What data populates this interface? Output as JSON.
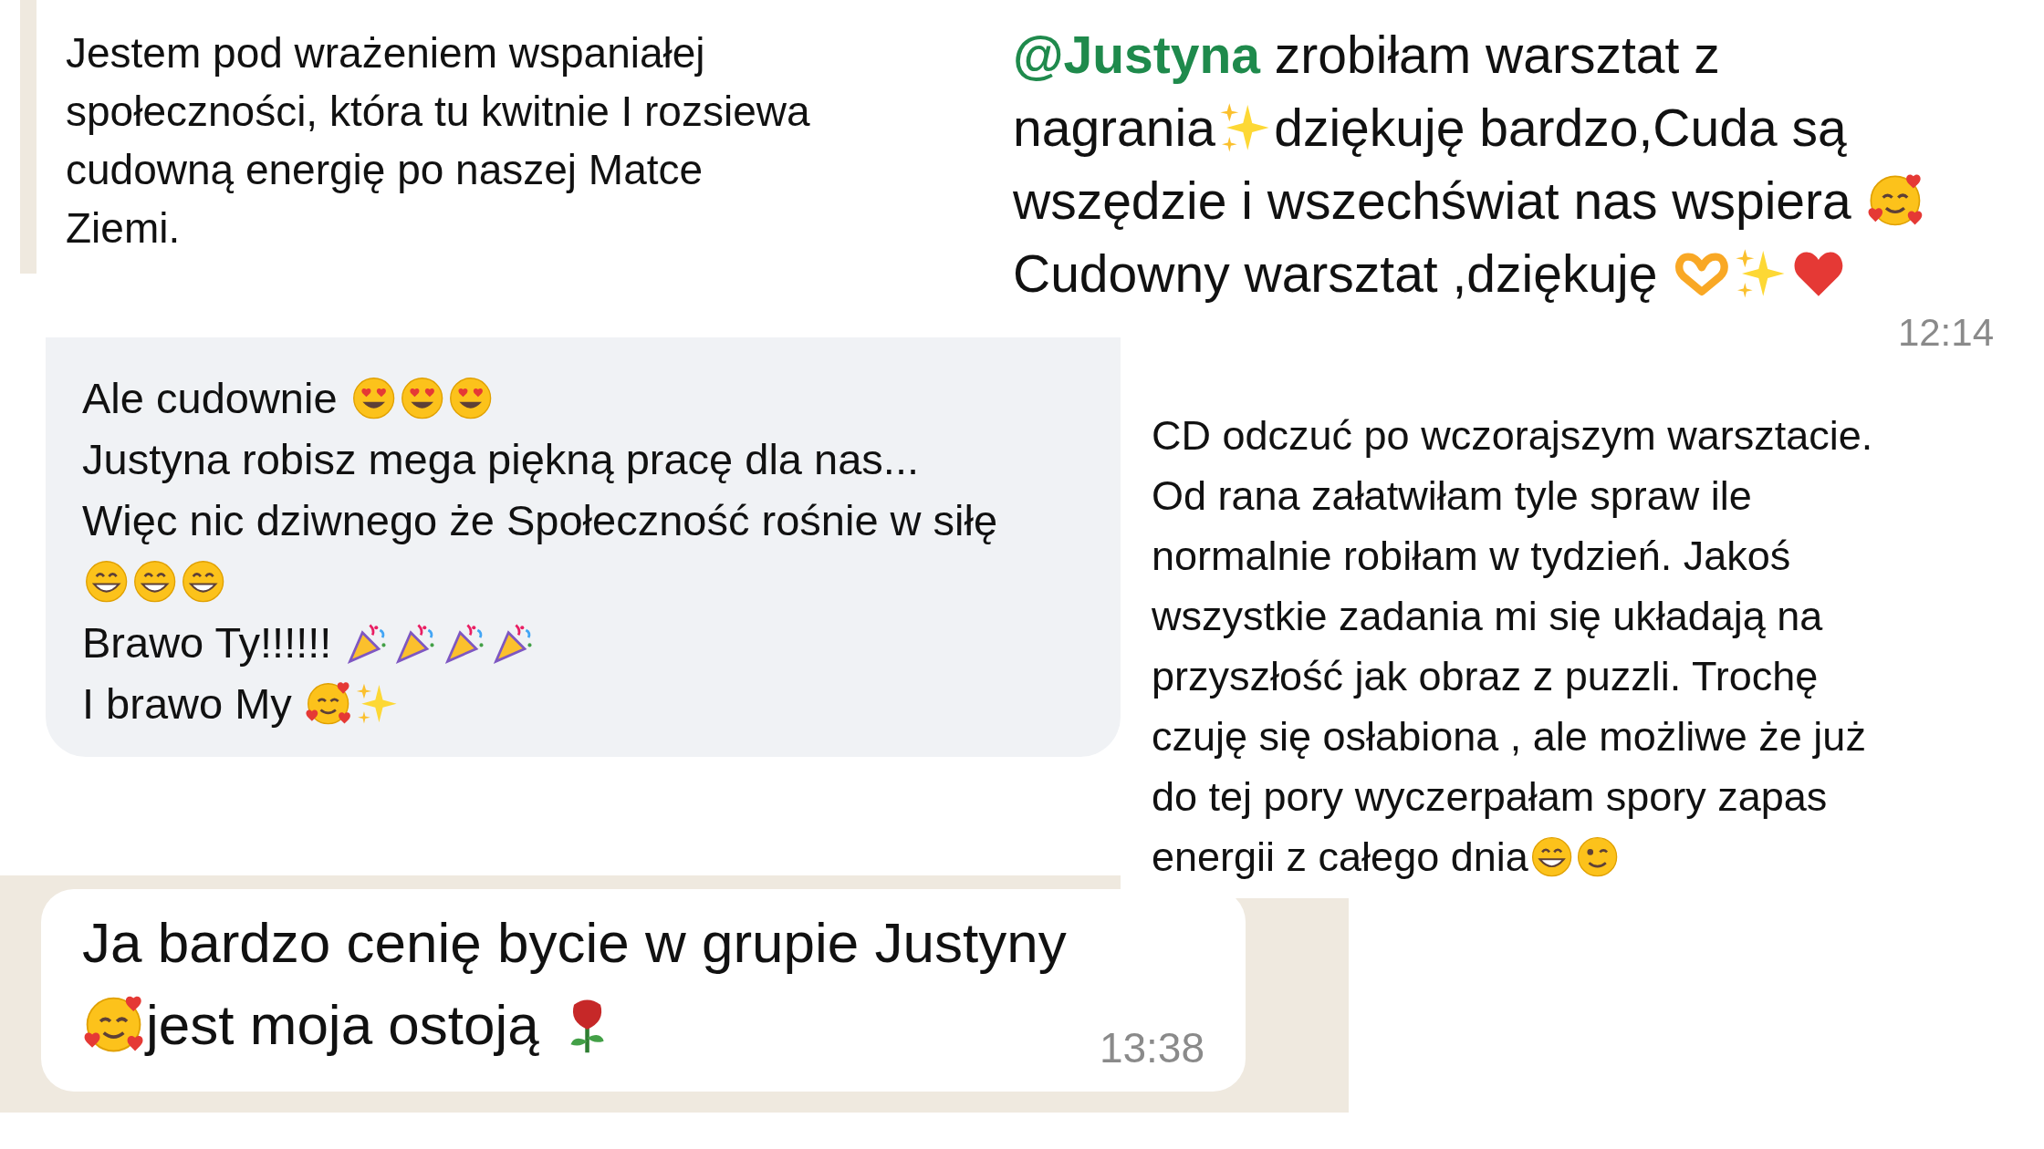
{
  "panels": [
    {
      "kind": "plain",
      "lines": [
        [
          {
            "kind": "text",
            "text": "Jestem pod wrażeniem wspaniałej"
          }
        ],
        [
          {
            "kind": "text",
            "text": "społeczności, która tu kwitnie I rozsiewa"
          }
        ],
        [
          {
            "kind": "text",
            "text": "cudowną energię po naszej Matce"
          }
        ],
        [
          {
            "kind": "text",
            "text": "Ziemi."
          }
        ]
      ]
    },
    {
      "kind": "chat",
      "time": "12:14",
      "lines": [
        [
          {
            "kind": "mention",
            "text": "@Justyna"
          },
          {
            "kind": "text",
            "text": " zrobiłam warsztat z"
          }
        ],
        [
          {
            "kind": "text",
            "text": "nagrania"
          },
          {
            "kind": "sparkles"
          },
          {
            "kind": "text",
            "text": "dziękuję bardzo,Cuda są"
          }
        ],
        [
          {
            "kind": "text",
            "text": "wszędzie i wszechświat nas wspiera "
          },
          {
            "kind": "hearts-face"
          }
        ],
        [
          {
            "kind": "text",
            "text": "Cudowny warsztat ,dziękuję "
          },
          {
            "kind": "heart-hands"
          },
          {
            "kind": "sparkles"
          },
          {
            "kind": "heart"
          }
        ]
      ]
    },
    {
      "kind": "comment",
      "lines": [
        [
          {
            "kind": "text",
            "text": "Ale cudownie "
          },
          {
            "kind": "heart-eyes"
          },
          {
            "kind": "heart-eyes"
          },
          {
            "kind": "heart-eyes"
          }
        ],
        [
          {
            "kind": "text",
            "text": "Justyna robisz mega piękną pracę dla nas..."
          }
        ],
        [
          {
            "kind": "text",
            "text": "Więc nic dziwnego że Społeczność rośnie w siłę"
          }
        ],
        [
          {
            "kind": "grin"
          },
          {
            "kind": "grin"
          },
          {
            "kind": "grin"
          }
        ],
        [
          {
            "kind": "text",
            "text": "Brawo Ty!!!!!! "
          },
          {
            "kind": "party"
          },
          {
            "kind": "party"
          },
          {
            "kind": "party"
          },
          {
            "kind": "party"
          }
        ],
        [
          {
            "kind": "text",
            "text": "I brawo My "
          },
          {
            "kind": "hearts-face"
          },
          {
            "kind": "sparkles"
          }
        ]
      ]
    },
    {
      "kind": "note",
      "lines": [
        [
          {
            "kind": "text",
            "text": "CD odczuć po wczorajszym warsztacie."
          }
        ],
        [
          {
            "kind": "text",
            "text": "Od rana załatwiłam tyle spraw ile"
          }
        ],
        [
          {
            "kind": "text",
            "text": "normalnie robiłam w tydzień. Jakoś"
          }
        ],
        [
          {
            "kind": "text",
            "text": "wszystkie zadania mi się układają na"
          }
        ],
        [
          {
            "kind": "text",
            "text": "przyszłość jak obraz z puzzli. Trochę"
          }
        ],
        [
          {
            "kind": "text",
            "text": "czuję się osłabiona , ale możliwe że już"
          }
        ],
        [
          {
            "kind": "text",
            "text": "do tej pory wyczerpałam spory zapas"
          }
        ],
        [
          {
            "kind": "text",
            "text": "energii z całego dnia"
          },
          {
            "kind": "grin"
          },
          {
            "kind": "wink"
          }
        ]
      ]
    },
    {
      "kind": "bubble",
      "time": "13:38",
      "lines": [
        [
          {
            "kind": "text",
            "text": "Ja bardzo cenię bycie w grupie Justyny"
          }
        ],
        [
          {
            "kind": "hearts-face"
          },
          {
            "kind": "text",
            "text": "jest moja ostoją "
          },
          {
            "kind": "rose"
          }
        ]
      ]
    }
  ]
}
